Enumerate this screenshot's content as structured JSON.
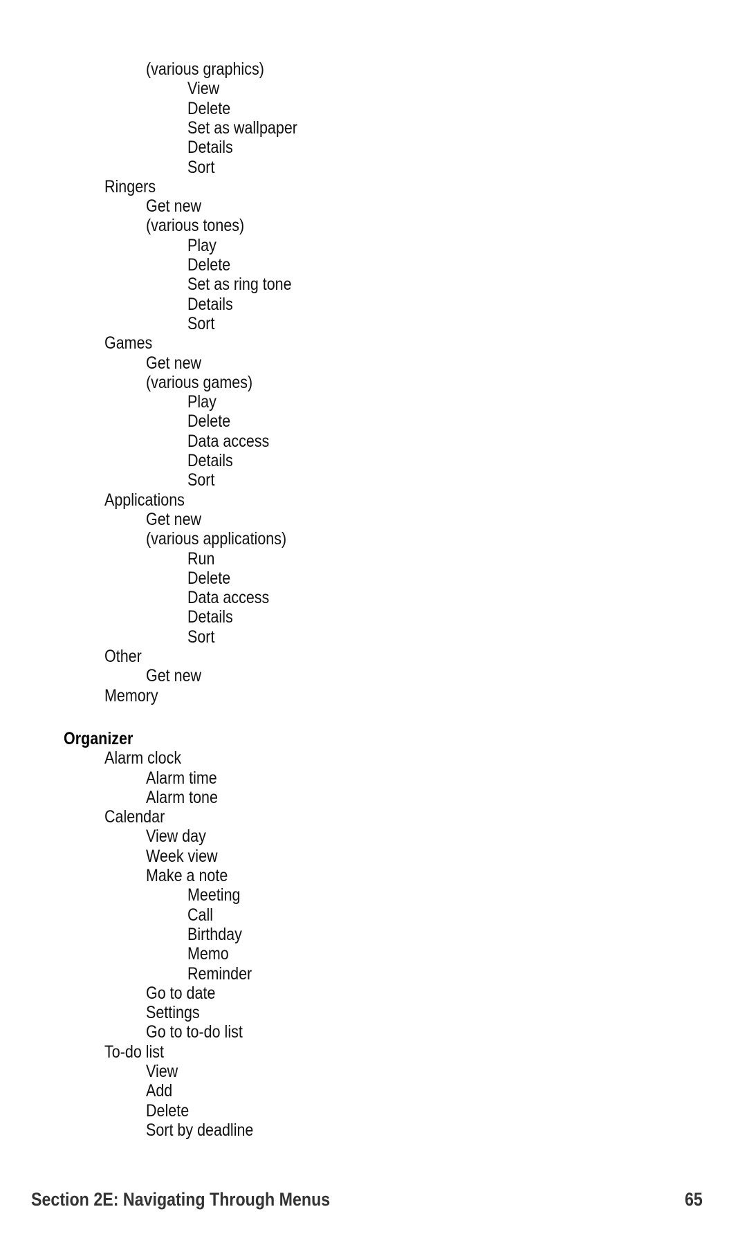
{
  "menu_lines": [
    {
      "level": 2,
      "text": "(various graphics)"
    },
    {
      "level": 3,
      "text": "View"
    },
    {
      "level": 3,
      "text": "Delete"
    },
    {
      "level": 3,
      "text": "Set as wallpaper"
    },
    {
      "level": 3,
      "text": "Details"
    },
    {
      "level": 3,
      "text": "Sort"
    },
    {
      "level": 1,
      "text": "Ringers"
    },
    {
      "level": 2,
      "text": "Get new"
    },
    {
      "level": 2,
      "text": "(various tones)"
    },
    {
      "level": 3,
      "text": "Play"
    },
    {
      "level": 3,
      "text": "Delete"
    },
    {
      "level": 3,
      "text": "Set as ring tone"
    },
    {
      "level": 3,
      "text": "Details"
    },
    {
      "level": 3,
      "text": "Sort"
    },
    {
      "level": 1,
      "text": "Games"
    },
    {
      "level": 2,
      "text": "Get new"
    },
    {
      "level": 2,
      "text": "(various games)"
    },
    {
      "level": 3,
      "text": "Play"
    },
    {
      "level": 3,
      "text": "Delete"
    },
    {
      "level": 3,
      "text": "Data access"
    },
    {
      "level": 3,
      "text": "Details"
    },
    {
      "level": 3,
      "text": "Sort"
    },
    {
      "level": 1,
      "text": "Applications"
    },
    {
      "level": 2,
      "text": "Get new"
    },
    {
      "level": 2,
      "text": "(various applications)"
    },
    {
      "level": 3,
      "text": "Run"
    },
    {
      "level": 3,
      "text": "Delete"
    },
    {
      "level": 3,
      "text": "Data access"
    },
    {
      "level": 3,
      "text": "Details"
    },
    {
      "level": 3,
      "text": "Sort"
    },
    {
      "level": 1,
      "text": "Other"
    },
    {
      "level": 2,
      "text": "Get new"
    },
    {
      "level": 1,
      "text": "Memory"
    },
    {
      "level": 0,
      "text": "Organizer",
      "heading": true,
      "gap_before": true
    },
    {
      "level": 1,
      "text": "Alarm clock"
    },
    {
      "level": 2,
      "text": "Alarm time"
    },
    {
      "level": 2,
      "text": "Alarm tone"
    },
    {
      "level": 1,
      "text": "Calendar"
    },
    {
      "level": 2,
      "text": "View day"
    },
    {
      "level": 2,
      "text": "Week view"
    },
    {
      "level": 2,
      "text": "Make a note"
    },
    {
      "level": 3,
      "text": "Meeting"
    },
    {
      "level": 3,
      "text": "Call"
    },
    {
      "level": 3,
      "text": "Birthday"
    },
    {
      "level": 3,
      "text": "Memo"
    },
    {
      "level": 3,
      "text": "Reminder"
    },
    {
      "level": 2,
      "text": "Go to date"
    },
    {
      "level": 2,
      "text": "Settings"
    },
    {
      "level": 2,
      "text": "Go to to-do list"
    },
    {
      "level": 1,
      "text": "To-do list"
    },
    {
      "level": 2,
      "text": "View"
    },
    {
      "level": 2,
      "text": "Add"
    },
    {
      "level": 2,
      "text": "Delete"
    },
    {
      "level": 2,
      "text": "Sort by deadline"
    }
  ],
  "footer": {
    "section_title": "Section 2E: Navigating Through Menus",
    "page_number": "65"
  }
}
